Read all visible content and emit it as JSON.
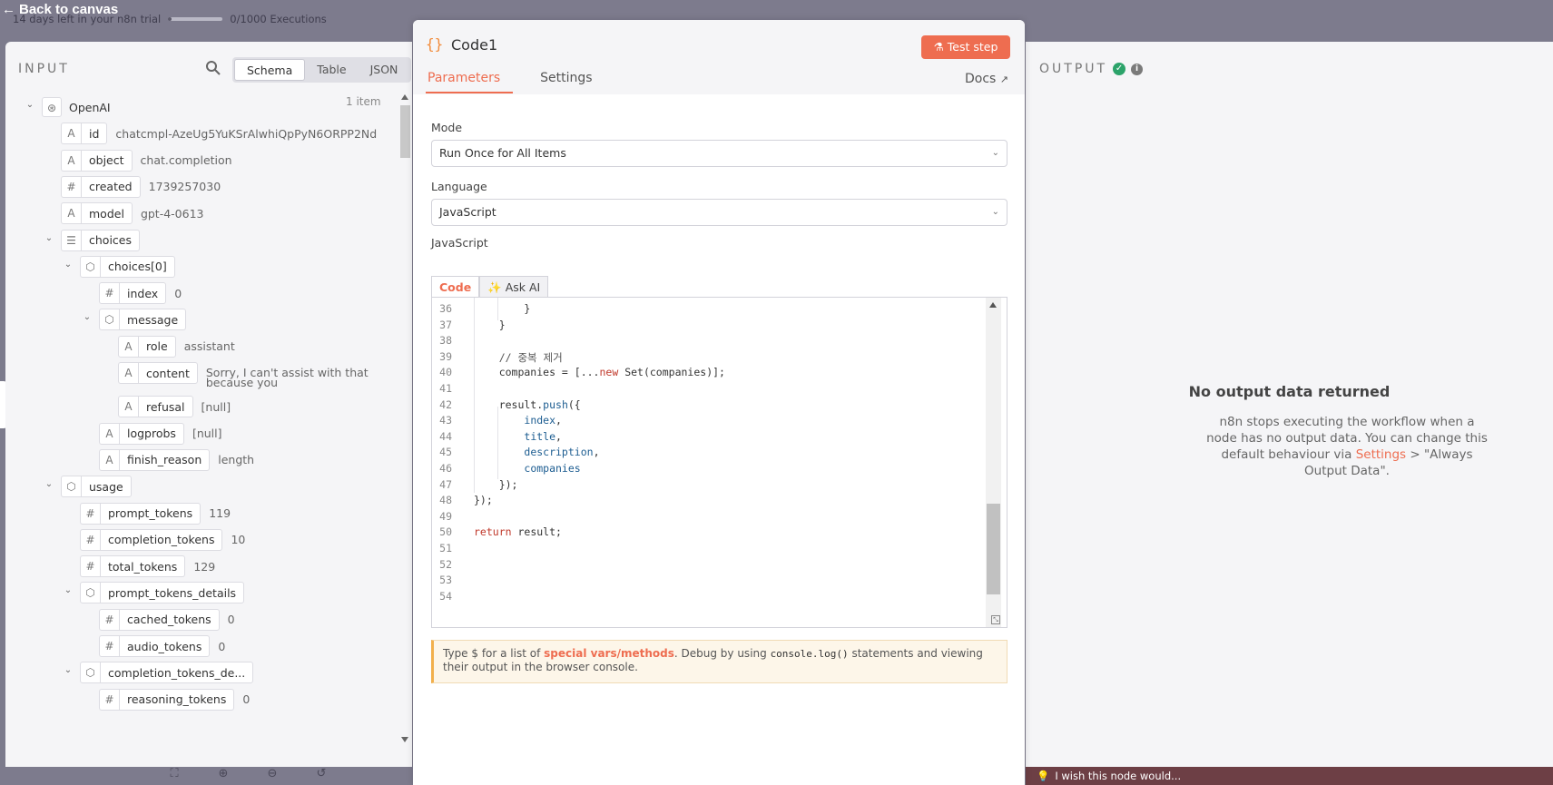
{
  "topbar": {
    "back_label": "Back to canvas",
    "trial_text": "14 days left in your n8n trial",
    "executions": "0/1000 Executions"
  },
  "feedback": {
    "text": "I wish this node would..."
  },
  "input": {
    "title": "INPUT",
    "views": [
      "Schema",
      "Table",
      "JSON"
    ],
    "active_view": "Schema",
    "items_count": "1 item",
    "tree": [
      {
        "depth": 0,
        "type": "openai",
        "key": "OpenAI",
        "value": "",
        "expanded": true
      },
      {
        "depth": 1,
        "type": "A",
        "key": "id",
        "value": "chatcmpl-AzeUg5YuKSrAlwhiQpPyN6ORPP2Nd"
      },
      {
        "depth": 1,
        "type": "A",
        "key": "object",
        "value": "chat.completion"
      },
      {
        "depth": 1,
        "type": "#",
        "key": "created",
        "value": "1739257030"
      },
      {
        "depth": 1,
        "type": "A",
        "key": "model",
        "value": "gpt-4-0613"
      },
      {
        "depth": 1,
        "type": "list",
        "key": "choices",
        "value": "",
        "expanded": true
      },
      {
        "depth": 2,
        "type": "obj",
        "key": "choices[0]",
        "value": "",
        "expanded": true
      },
      {
        "depth": 3,
        "type": "#",
        "key": "index",
        "value": "0"
      },
      {
        "depth": 3,
        "type": "obj",
        "key": "message",
        "value": "",
        "expanded": true
      },
      {
        "depth": 4,
        "type": "A",
        "key": "role",
        "value": "assistant"
      },
      {
        "depth": 4,
        "type": "A",
        "key": "content",
        "value": "Sorry, I can't assist with that",
        "value2": "because you"
      },
      {
        "depth": 4,
        "type": "A",
        "key": "refusal",
        "value": "[null]"
      },
      {
        "depth": 3,
        "type": "A",
        "key": "logprobs",
        "value": "[null]"
      },
      {
        "depth": 3,
        "type": "A",
        "key": "finish_reason",
        "value": "length"
      },
      {
        "depth": 1,
        "type": "obj",
        "key": "usage",
        "value": "",
        "expanded": true
      },
      {
        "depth": 2,
        "type": "#",
        "key": "prompt_tokens",
        "value": "119"
      },
      {
        "depth": 2,
        "type": "#",
        "key": "completion_tokens",
        "value": "10"
      },
      {
        "depth": 2,
        "type": "#",
        "key": "total_tokens",
        "value": "129"
      },
      {
        "depth": 2,
        "type": "obj",
        "key": "prompt_tokens_details",
        "value": "",
        "expanded": true
      },
      {
        "depth": 3,
        "type": "#",
        "key": "cached_tokens",
        "value": "0"
      },
      {
        "depth": 3,
        "type": "#",
        "key": "audio_tokens",
        "value": "0"
      },
      {
        "depth": 2,
        "type": "obj",
        "key": "completion_tokens_de...",
        "value": "",
        "expanded": true
      },
      {
        "depth": 3,
        "type": "#",
        "key": "reasoning_tokens",
        "value": "0"
      }
    ]
  },
  "node": {
    "name": "Code1",
    "icon": "curly-braces-icon",
    "test_label": "Test step",
    "tabs": [
      "Parameters",
      "Settings"
    ],
    "docs_label": "Docs",
    "mode_label": "Mode",
    "mode_value": "Run Once for All Items",
    "language_label": "Language",
    "language_value": "JavaScript",
    "code_label": "JavaScript",
    "code_tabs": [
      "Code",
      "✨ Ask AI"
    ],
    "code_lines": [
      {
        "n": "36",
        "text": "        }"
      },
      {
        "n": "37",
        "text": "    }"
      },
      {
        "n": "38",
        "text": ""
      },
      {
        "n": "39",
        "text": "    // 중복 제거"
      },
      {
        "n": "40",
        "text": "    companies = [...new Set(companies)];"
      },
      {
        "n": "41",
        "text": ""
      },
      {
        "n": "42",
        "text": "    result.push({"
      },
      {
        "n": "43",
        "text": "        index,"
      },
      {
        "n": "44",
        "text": "        title,"
      },
      {
        "n": "45",
        "text": "        description,"
      },
      {
        "n": "46",
        "text": "        companies"
      },
      {
        "n": "47",
        "text": "    });"
      },
      {
        "n": "48",
        "text": "});"
      },
      {
        "n": "49",
        "text": ""
      },
      {
        "n": "50",
        "text": "return result;"
      },
      {
        "n": "51",
        "text": ""
      },
      {
        "n": "52",
        "text": ""
      },
      {
        "n": "53",
        "text": ""
      },
      {
        "n": "54",
        "text": ""
      }
    ],
    "hint": {
      "pre": "Type $ for a list of ",
      "link": "special vars/methods",
      "mid": ". Debug by using ",
      "code": "console.log()",
      "post": " statements and viewing their output in the browser console."
    }
  },
  "output": {
    "title": "OUTPUT",
    "empty_title": "No output data returned",
    "empty_pre": "n8n stops executing the workflow when a node has no output data. You can change this default behaviour via ",
    "empty_link": "Settings",
    "empty_post": " > \"Always Output Data\".",
    "accent": "#ee6d50",
    "success": "#2ca36a"
  }
}
